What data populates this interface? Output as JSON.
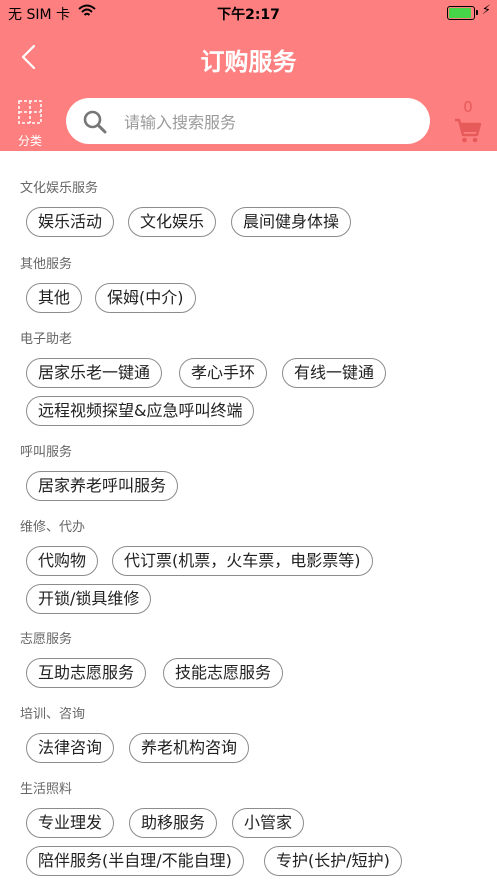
{
  "status_bar": {
    "carrier": "无 SIM 卡",
    "time": "下午2:17",
    "icons": [
      "wifi-icon",
      "battery-icon",
      "charging-bolt-icon"
    ],
    "battery_level": 0.9,
    "battery_color": "#46d449"
  },
  "nav": {
    "title": "订购服务",
    "back_icon": "chevron-left-icon"
  },
  "toolbar": {
    "category_label": "分类",
    "category_icon": "grid-icon",
    "search_placeholder": "请输入搜索服务",
    "search_value": "",
    "search_icon": "search-icon",
    "cart_count": "0",
    "cart_icon": "shopping-cart-icon"
  },
  "colors": {
    "header_bg": "#fe7f7f",
    "cart_count": "#e65a5a",
    "tag_border": "#8c8c8c",
    "section_title": "#666666"
  },
  "sections": [
    {
      "title": "文化娱乐服务",
      "rows": [
        [
          "娱乐活动",
          "文化娱乐",
          "晨间健身体操"
        ]
      ]
    },
    {
      "title": "其他服务",
      "rows": [
        [
          "其他",
          "保姆(中介)"
        ]
      ]
    },
    {
      "title": "电子助老",
      "rows": [
        [
          "居家乐老一键通",
          "孝心手环",
          "有线一键通"
        ],
        [
          "远程视频探望&应急呼叫终端"
        ]
      ]
    },
    {
      "title": "呼叫服务",
      "rows": [
        [
          "居家养老呼叫服务"
        ]
      ]
    },
    {
      "title": "维修、代办",
      "rows": [
        [
          "代购物",
          "代订票(机票，火车票，电影票等)"
        ],
        [
          "开锁/锁具维修"
        ]
      ]
    },
    {
      "title": "志愿服务",
      "rows": [
        [
          "互助志愿服务",
          "技能志愿服务"
        ]
      ]
    },
    {
      "title": "培训、咨询",
      "rows": [
        [
          "法律咨询",
          "养老机构咨询"
        ]
      ]
    },
    {
      "title": "生活照料",
      "rows": [
        [
          "专业理发",
          "助移服务",
          "小管家"
        ],
        [
          "陪伴服务(半自理/不能自理)",
          "专护(长护/短护)"
        ]
      ]
    }
  ]
}
